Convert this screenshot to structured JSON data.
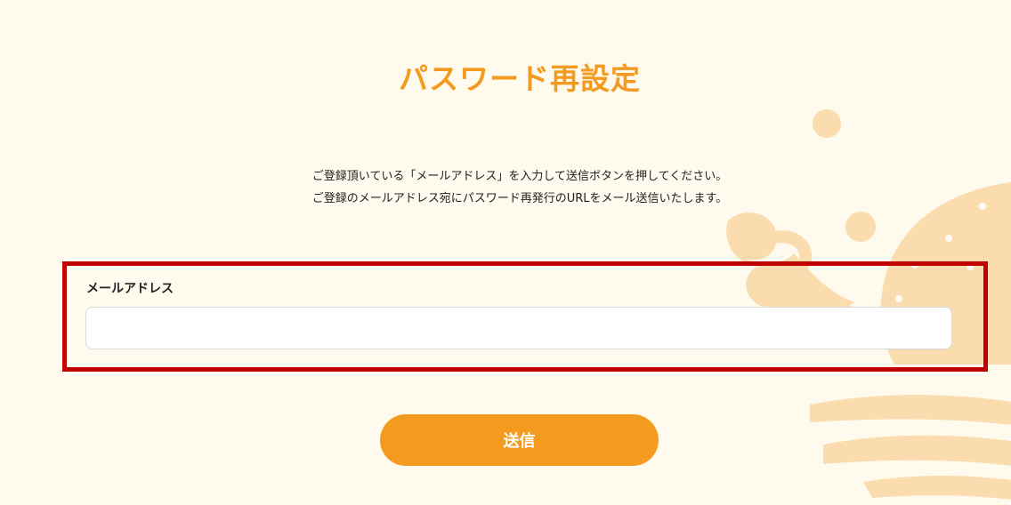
{
  "page": {
    "title": "パスワード再設定",
    "description_line1": "ご登録頂いている「メールアドレス」を入力して送信ボタンを押してください。",
    "description_line2": "ご登録のメールアドレス宛にパスワード再発行のURLをメール送信いたします。"
  },
  "form": {
    "email_label": "メールアドレス",
    "email_value": "",
    "email_placeholder": "",
    "submit_label": "送信"
  },
  "colors": {
    "accent": "#f39a1f",
    "background": "#fefaee",
    "highlight_border": "#c00000",
    "decoration": "#fbdcae"
  }
}
